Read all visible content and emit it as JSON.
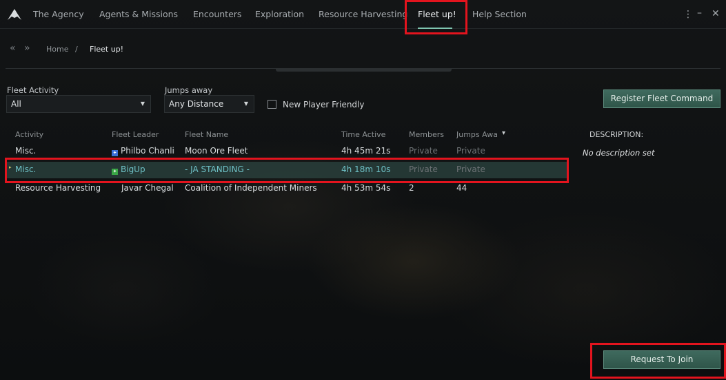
{
  "nav": {
    "tabs": [
      {
        "label": "The Agency"
      },
      {
        "label": "Agents & Missions"
      },
      {
        "label": "Encounters"
      },
      {
        "label": "Exploration"
      },
      {
        "label": "Resource Harvesting"
      },
      {
        "label": "Fleet up!"
      },
      {
        "label": "Help Section"
      }
    ],
    "active_tab": "Fleet up!",
    "icons": [
      "logo-icon",
      "more-vert-icon",
      "minimize-icon",
      "close-icon"
    ]
  },
  "breadcrumb": {
    "back_icon": "«",
    "forward_icon": "»",
    "home": "Home",
    "separator": "/",
    "current": "Fleet up!"
  },
  "filters": {
    "activity_label": "Fleet Activity",
    "activity_value": "All",
    "jumps_label": "Jumps away",
    "jumps_value": "Any Distance",
    "new_player_label": "New Player Friendly",
    "new_player_checked": false
  },
  "buttons": {
    "register": "Register Fleet Command",
    "request": "Request To Join"
  },
  "table": {
    "headers": [
      "Activity",
      "Fleet Leader",
      "Fleet Name",
      "Time Active",
      "Members",
      "Jumps Awa"
    ],
    "sort_indicator": "▾",
    "rows": [
      {
        "activity": "Misc.",
        "leader": "Philbo Chanlir",
        "leader_badge_color": "#3a6fd8",
        "fleet_name": "Moon Ore Fleet",
        "time": "4h 45m 21s",
        "members": "Private",
        "jumps": "Private"
      },
      {
        "activity": "Misc.",
        "leader": "BigUp",
        "leader_badge_color": "#3aa646",
        "fleet_name": "- JA STANDING -",
        "time": "4h 18m 10s",
        "members": "Private",
        "jumps": "Private",
        "selected": true
      },
      {
        "activity": "Resource Harvesting",
        "leader": "Javar Chegal",
        "fleet_name": "Coalition of Independent Miners",
        "time": "4h 53m 54s",
        "members": "2",
        "jumps": "44"
      }
    ]
  },
  "description": {
    "title": "DESCRIPTION:",
    "text": "No description set"
  },
  "colors": {
    "accent": "#6fc2c7",
    "button": "#3f6a5e",
    "highlight_box": "#e3141e"
  }
}
